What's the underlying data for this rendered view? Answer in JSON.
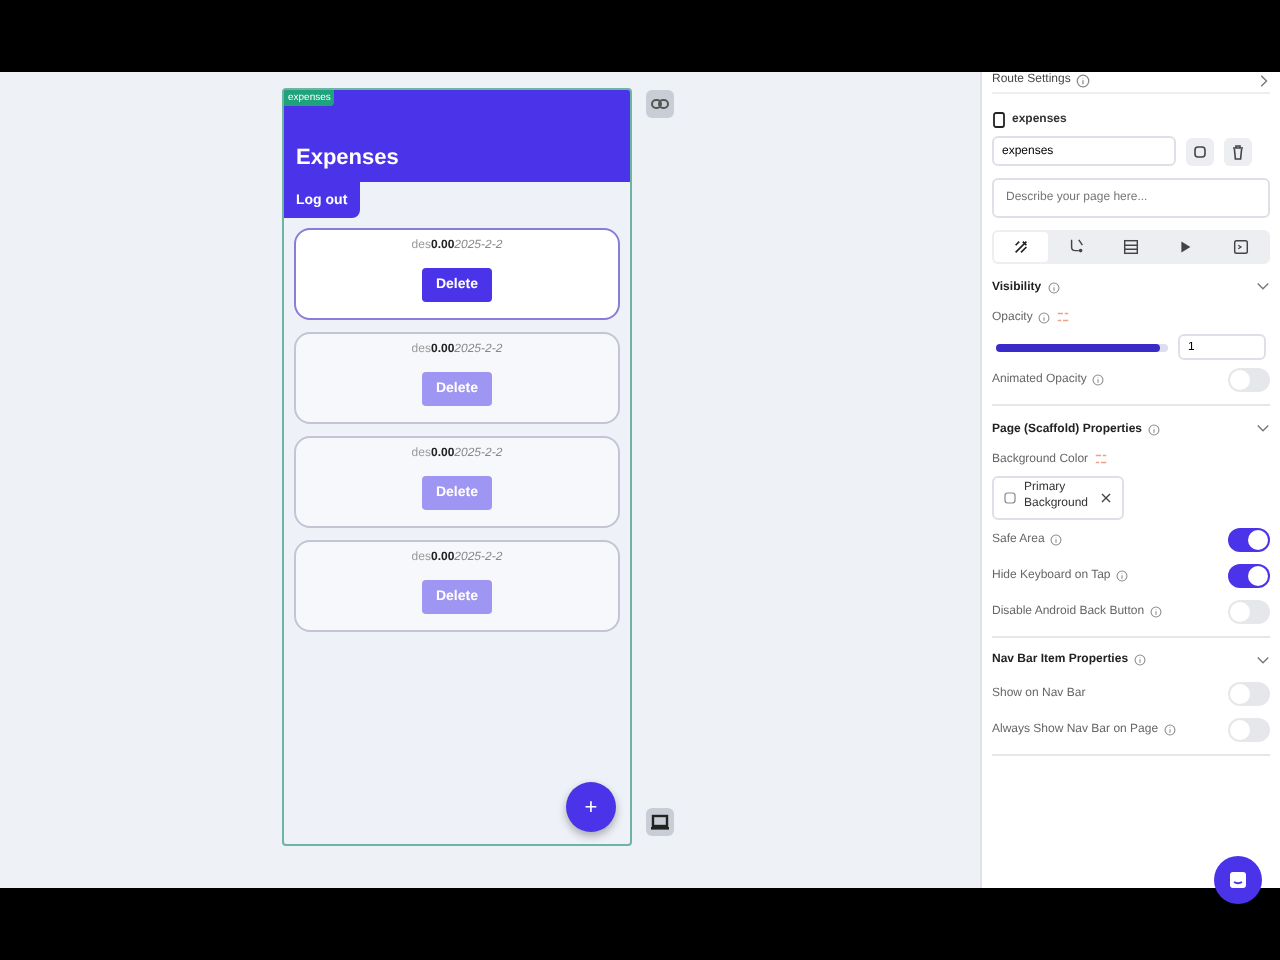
{
  "canvas": {
    "page_tag": "expenses",
    "app_title": "Expenses",
    "logout_button": "Log out",
    "cards": [
      {
        "description": "des",
        "amount": "0.00",
        "date": "2025-2-2",
        "button": "Delete",
        "selected": true
      },
      {
        "description": "des",
        "amount": "0.00",
        "date": "2025-2-2",
        "button": "Delete",
        "selected": false
      },
      {
        "description": "des",
        "amount": "0.00",
        "date": "2025-2-2",
        "button": "Delete",
        "selected": false
      },
      {
        "description": "des",
        "amount": "0.00",
        "date": "2025-2-2",
        "button": "Delete",
        "selected": false
      }
    ],
    "fab": "+"
  },
  "panel": {
    "header": "Route Settings",
    "page_name": "expenses",
    "name_value": "expenses",
    "description_placeholder": "Describe your page here...",
    "tools": [
      {
        "kind": "wand",
        "selected": true
      },
      {
        "kind": "flow",
        "selected": false
      },
      {
        "kind": "table",
        "selected": false
      },
      {
        "kind": "play",
        "selected": false
      },
      {
        "kind": "code",
        "selected": false
      }
    ],
    "sections": [
      {
        "title": "Visibility",
        "rows": [
          {
            "kind": "label",
            "label": "Opacity",
            "binding": true
          },
          {
            "kind": "slider",
            "level": 0.95,
            "value": "1"
          },
          {
            "kind": "toggle",
            "label": "Animated Opacity",
            "info": true,
            "on": false
          }
        ]
      },
      {
        "title": "Page (Scaffold) Properties",
        "rows": [
          {
            "kind": "label",
            "label": "Background Color",
            "binding": true
          },
          {
            "kind": "chip",
            "value": "Primary Background"
          },
          {
            "kind": "toggle",
            "label": "Safe Area",
            "info": true,
            "on": true
          },
          {
            "kind": "toggle",
            "label": "Hide Keyboard on Tap",
            "info": true,
            "on": true
          },
          {
            "kind": "toggle",
            "label": "Disable Android Back Button",
            "info": true,
            "on": false
          }
        ]
      },
      {
        "title": "Nav Bar Item Properties",
        "rows": [
          {
            "kind": "toggle",
            "label": "Show on Nav Bar",
            "info": false,
            "on": false
          },
          {
            "kind": "toggle",
            "label": "Always Show Nav Bar on Page",
            "info": true,
            "on": false
          }
        ]
      }
    ]
  }
}
